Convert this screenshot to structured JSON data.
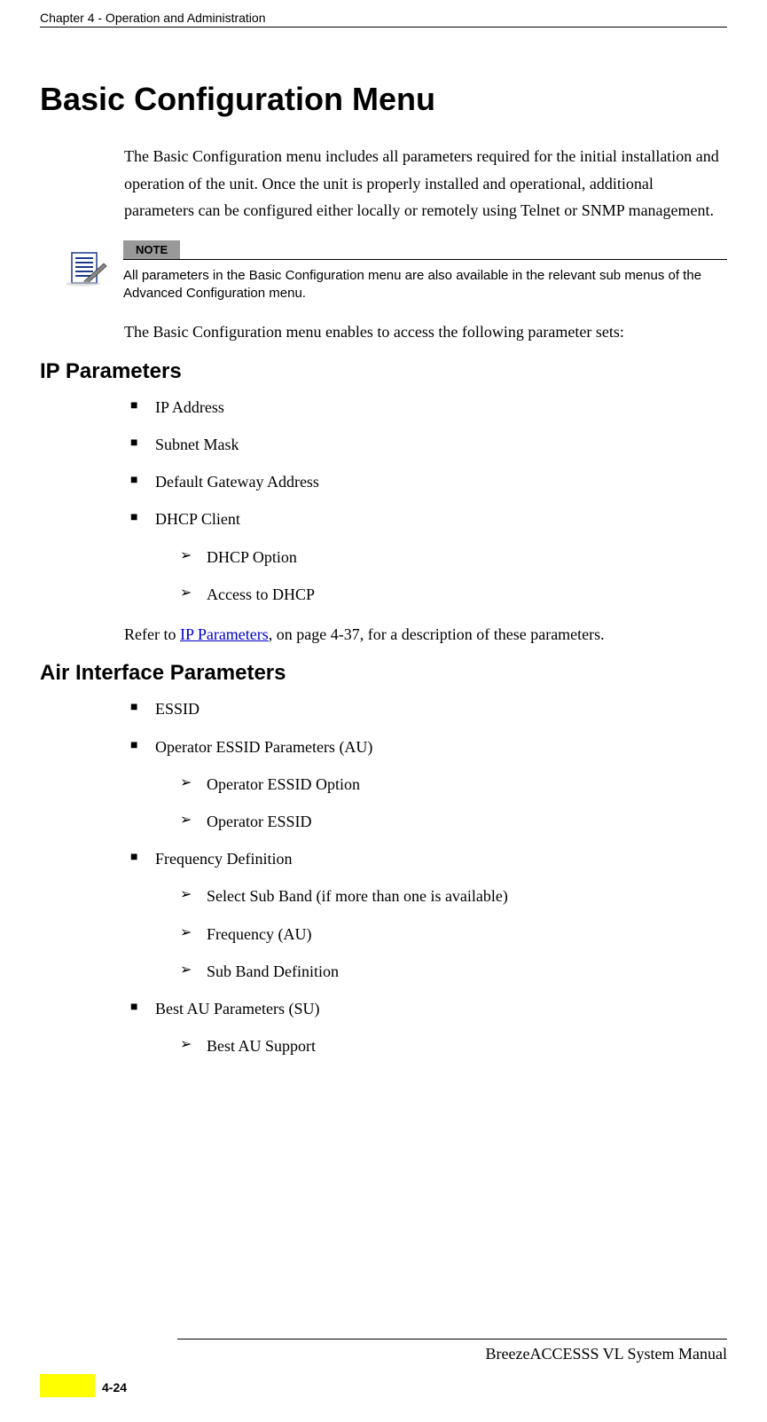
{
  "header": {
    "chapter_title": "Chapter 4 - Operation and Administration"
  },
  "main": {
    "title": "Basic Configuration Menu",
    "intro": "The Basic Configuration menu includes all parameters required for the initial installation and operation of the unit. Once the unit is properly installed and operational, additional parameters can be configured either locally or remotely using Telnet or SNMP management.",
    "note": {
      "label": "NOTE",
      "text": "All parameters in the Basic Configuration menu are also available in the relevant sub menus of the Advanced Configuration menu."
    },
    "after_note": "The Basic Configuration menu enables to access the following parameter sets:",
    "sections": [
      {
        "heading": "IP Parameters",
        "items": [
          {
            "text": "IP Address"
          },
          {
            "text": "Subnet Mask"
          },
          {
            "text": "Default Gateway Address"
          },
          {
            "text": "DHCP Client",
            "subitems": [
              {
                "text": "DHCP Option"
              },
              {
                "text": "Access to DHCP"
              }
            ]
          }
        ],
        "refer": {
          "prefix": "Refer to ",
          "link": "IP Parameters",
          "suffix": ", on page 4-37, for a description of these parameters."
        }
      },
      {
        "heading": "Air Interface Parameters",
        "items": [
          {
            "text": "ESSID"
          },
          {
            "text": "Operator ESSID Parameters (AU)",
            "subitems": [
              {
                "text": "Operator ESSID Option"
              },
              {
                "text": "Operator ESSID"
              }
            ]
          },
          {
            "text": "Frequency Definition",
            "subitems": [
              {
                "text": "Select Sub Band (if more than one is available)"
              },
              {
                "text": "Frequency (AU)"
              },
              {
                "text": "Sub Band Definition"
              }
            ]
          },
          {
            "text": "Best AU Parameters (SU)",
            "subitems": [
              {
                "text": "Best AU Support"
              }
            ]
          }
        ]
      }
    ]
  },
  "footer": {
    "manual_name": "BreezeACCESSS VL System Manual",
    "page_number": "4-24"
  }
}
